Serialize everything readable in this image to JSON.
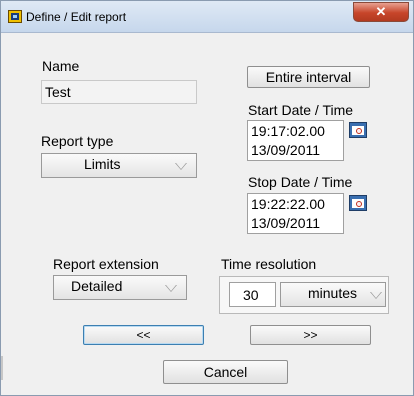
{
  "window": {
    "title": "Define / Edit report",
    "close_glyph": "✕"
  },
  "name": {
    "label": "Name",
    "value": "Test"
  },
  "report_type": {
    "label": "Report type",
    "value": "Limits"
  },
  "entire_interval_label": "Entire interval",
  "start": {
    "label": "Start Date / Time",
    "time": "19:17:02.00",
    "date": "13/09/2011"
  },
  "stop": {
    "label": "Stop Date / Time",
    "time": "19:22:22.00",
    "date": "13/09/2011"
  },
  "report_extension": {
    "label": "Report extension",
    "value": "Detailed"
  },
  "time_resolution": {
    "label": "Time resolution",
    "value": "30",
    "unit": "minutes"
  },
  "nav": {
    "prev_label": "<<",
    "next_label": ">>"
  },
  "cancel_label": "Cancel",
  "icons": {
    "app": "labview-app-icon",
    "calendar": "calendar-clock-icon",
    "close": "close-icon",
    "dropdown": "triangle-down-icon"
  }
}
